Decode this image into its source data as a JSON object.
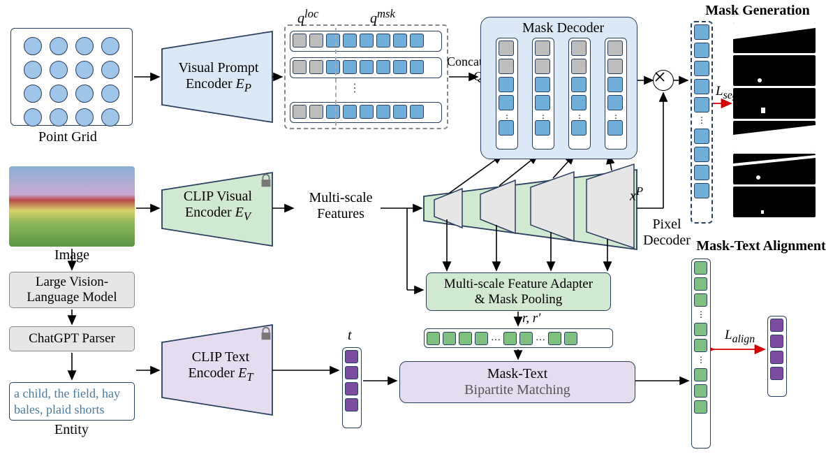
{
  "labels": {
    "point_grid": "Point Grid",
    "image": "Image",
    "entity": "Entity",
    "vpe_l1": "Visual Prompt",
    "vpe_l2": "Encoder ",
    "vpe_sym": "E_P",
    "cve_l1": "CLIP Visual",
    "cve_l2": "Encoder ",
    "cve_sym": "E_V",
    "cte_l1": "CLIP Text",
    "cte_l2": "Encoder ",
    "cte_sym": "E_T",
    "qloc": "q",
    "qloc_sup": "loc",
    "qmsk": "q",
    "qmsk_sup": "msk",
    "concat_l1": "Concatenate",
    "concat_sym": "Q",
    "msfeat_l1": "Multi-scale",
    "msfeat_l2": "Features",
    "mask_decoder": "Mask Decoder",
    "pixel_decoder_l1": "Pixel",
    "pixel_decoder_l2": "Decoder",
    "adapter_l1": "Multi-scale Feature Adapter",
    "adapter_l2": "& Mask Pooling",
    "rr": "r, r'",
    "xp": "x",
    "xp_sup": "P",
    "t": "t",
    "match_l1": "Mask-Text",
    "match_l2": "Bipartite Matching",
    "lvlm_l1": "Large Vision-",
    "lvlm_l2": "Language Model",
    "parser": "ChatGPT Parser",
    "entities": "a child, the field, hay bales, plaid shorts",
    "maskgen": "Mask Generation",
    "maskalign": "Mask-Text Alignment",
    "lseg": "L",
    "lseg_sub": "seg",
    "lalign": "L",
    "lalign_sub": "align"
  },
  "colors": {
    "blue": "#6faed9",
    "green": "#7fbf7f",
    "purple": "#7b4ca0",
    "gray": "#bdbdbd"
  }
}
